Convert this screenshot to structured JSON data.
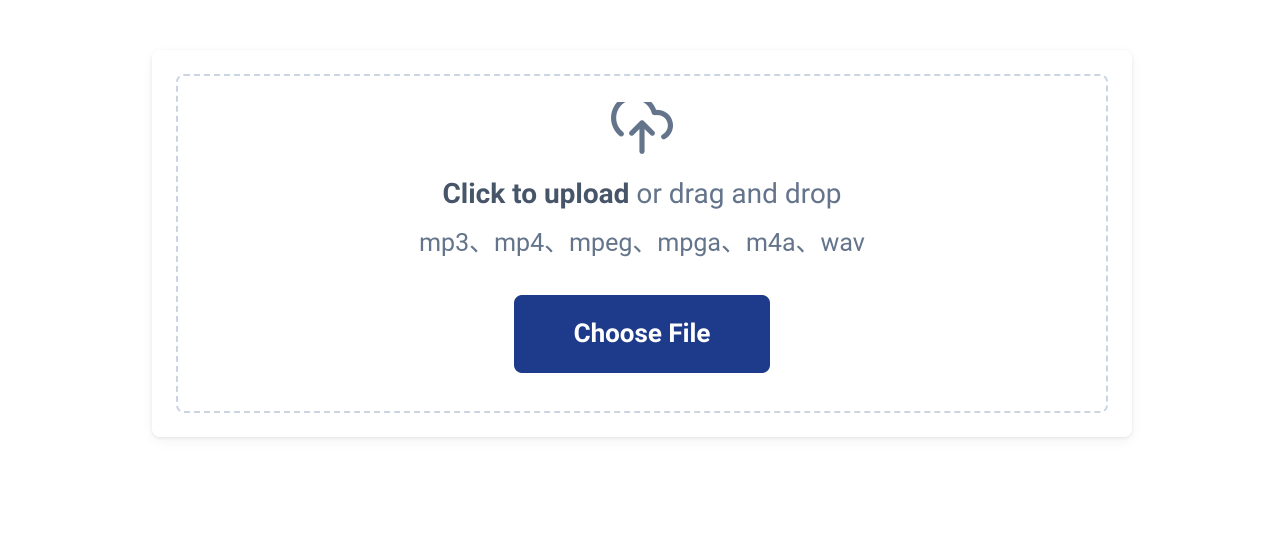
{
  "upload": {
    "click_label": "Click to upload",
    "drag_label": " or drag and drop",
    "formats": "mp3、mp4、mpeg、mpga、m4a、wav",
    "button_label": "Choose File"
  }
}
